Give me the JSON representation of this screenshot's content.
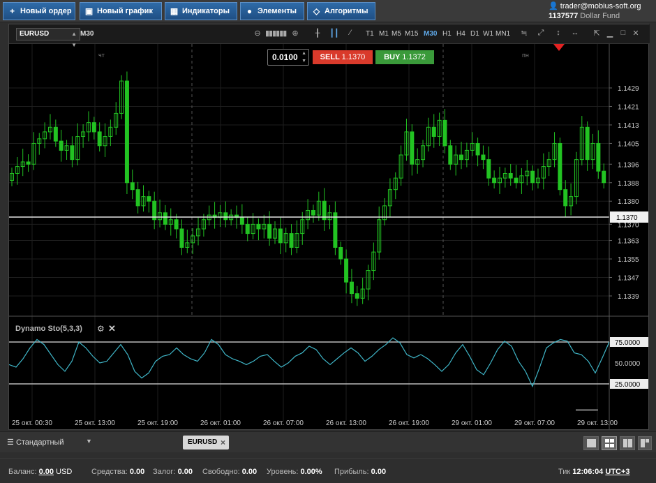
{
  "toolbar": {
    "buttons": [
      {
        "label": "Новый ордер",
        "icon": "plus-icon"
      },
      {
        "label": "Новый график",
        "icon": "chart-window-icon"
      },
      {
        "label": "Индикаторы",
        "icon": "indicators-icon"
      },
      {
        "label": "Элементы",
        "icon": "elements-icon"
      },
      {
        "label": "Алгоритмы",
        "icon": "diamond-icon"
      }
    ],
    "account": {
      "email": "trader@mobius-soft.org",
      "number": "1137577",
      "fund": "Dollar Fund"
    }
  },
  "chart": {
    "symbol": "EURUSD",
    "timeframe": "M30",
    "timeframes": [
      "T1",
      "M1",
      "M5",
      "M15",
      "M30",
      "H1",
      "H4",
      "D1",
      "W1",
      "MN1"
    ],
    "active_timeframe": "M30",
    "trade": {
      "lot": "0.0100",
      "sell_label": "SELL",
      "sell_price": "1.1370",
      "buy_label": "BUY",
      "buy_price": "1.1372"
    },
    "day_labels": [
      "чт",
      "пн"
    ],
    "current_price": "1.1370",
    "indicator": {
      "name": "Dynamo Sto(5,3,3)",
      "levels": [
        "75.0000",
        "50.0000",
        "25.0000"
      ]
    },
    "colors": {
      "up": "#22c322",
      "down": "#22c322",
      "stoch": "#3fb6c8",
      "sell": "#d93a2b",
      "buy": "#3a9a3a",
      "active_tf": "#5fa8e8"
    }
  },
  "chart_data": {
    "type": "candlestick",
    "y_ticks": [
      "1.1429",
      "1.1421",
      "1.1413",
      "1.1405",
      "1.1396",
      "1.1388",
      "1.1380",
      "1.1370",
      "1.1363",
      "1.1355",
      "1.1347",
      "1.1339"
    ],
    "x_ticks": [
      "25 окт. 00:30",
      "25 окт. 13:00",
      "25 окт. 19:00",
      "26 окт. 01:00",
      "26 окт. 07:00",
      "26 окт. 13:00",
      "26 окт. 19:00",
      "29 окт. 01:00",
      "29 окт. 07:00",
      "29 окт. 13:00"
    ],
    "close": [
      1.1392,
      1.1395,
      1.1397,
      1.1396,
      1.1405,
      1.1407,
      1.141,
      1.1412,
      1.1406,
      1.1402,
      1.1404,
      1.1398,
      1.1408,
      1.141,
      1.1414,
      1.141,
      1.1404,
      1.1408,
      1.1412,
      1.1418,
      1.1432,
      1.1388,
      1.1385,
      1.1378,
      1.1382,
      1.138,
      1.1372,
      1.1375,
      1.137,
      1.1372,
      1.1368,
      1.136,
      1.1362,
      1.1365,
      1.1368,
      1.1372,
      1.1374,
      1.1373,
      1.1375,
      1.1372,
      1.1374,
      1.1373,
      1.137,
      1.1366,
      1.137,
      1.1368,
      1.137,
      1.1364,
      1.1368,
      1.1362,
      1.1366,
      1.136,
      1.1366,
      1.1372,
      1.1376,
      1.1374,
      1.138,
      1.1372,
      1.1375,
      1.136,
      1.1355,
      1.1345,
      1.134,
      1.1338,
      1.1342,
      1.135,
      1.1358,
      1.1372,
      1.1378,
      1.1385,
      1.139,
      1.14,
      1.141,
      1.1396,
      1.1398,
      1.1404,
      1.1412,
      1.1408,
      1.1415,
      1.1404,
      1.1396,
      1.14,
      1.1398,
      1.1402,
      1.1405,
      1.14,
      1.1398,
      1.139,
      1.1388,
      1.139,
      1.1392,
      1.139,
      1.1388,
      1.1391,
      1.1393,
      1.1388,
      1.139,
      1.1395,
      1.1398,
      1.1405,
      1.1385,
      1.1378,
      1.1382,
      1.1398,
      1.1412,
      1.1398,
      1.1405,
      1.1393,
      1.1388
    ],
    "stoch": [
      48,
      45,
      55,
      68,
      78,
      72,
      60,
      48,
      40,
      52,
      75,
      68,
      58,
      50,
      52,
      62,
      72,
      60,
      40,
      32,
      38,
      52,
      58,
      60,
      68,
      60,
      55,
      52,
      62,
      78,
      72,
      60,
      55,
      52,
      48,
      52,
      58,
      60,
      52,
      45,
      50,
      58,
      62,
      70,
      66,
      55,
      48,
      55,
      62,
      68,
      62,
      52,
      58,
      66,
      72,
      80,
      74,
      60,
      56,
      60,
      55,
      48,
      40,
      48,
      62,
      72,
      58,
      42,
      36,
      50,
      66,
      76,
      70,
      52,
      40,
      22,
      44,
      68,
      74,
      78,
      76,
      62,
      60,
      52,
      38,
      56,
      75
    ]
  },
  "tabs": {
    "layout": "Стандартный",
    "symbol_tab": "EURUSD"
  },
  "status": {
    "balance_label": "Баланс:",
    "balance": "0.00",
    "balance_ccy": "USD",
    "equity_label": "Средства:",
    "equity": "0.00",
    "margin_label": "Залог:",
    "margin": "0.00",
    "free_label": "Свободно:",
    "free": "0.00",
    "level_label": "Уровень:",
    "level": "0.00%",
    "profit_label": "Прибыль:",
    "profit": "0.00",
    "tick_label": "Тик",
    "tick_time": "12:06:04",
    "tz": "UTC+3"
  }
}
